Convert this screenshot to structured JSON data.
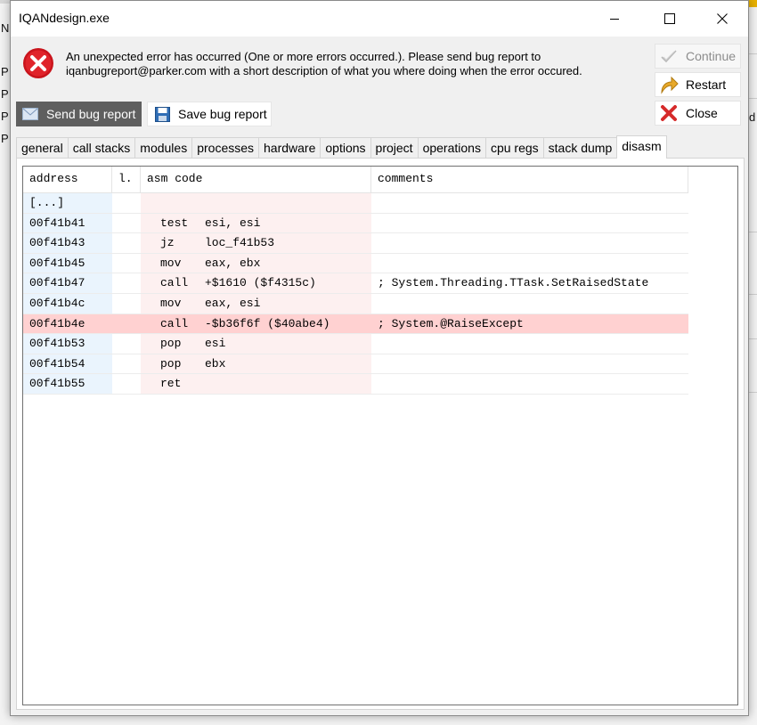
{
  "background": {
    "left_letters": [
      "N",
      "P",
      "P",
      "P",
      "P"
    ],
    "right_letter": "d"
  },
  "window": {
    "title": "IQANdesign.exe"
  },
  "error": {
    "message_line1": "An unexpected error has occurred (One or more errors occurred.). Please send bug report to",
    "message_line2": "iqanbugreport@parker.com with a short description of what you where doing when the error occured."
  },
  "side_buttons": {
    "continue_label": "Continue",
    "restart_label": "Restart",
    "close_label": "Close"
  },
  "bug_buttons": {
    "send_label": "Send bug report",
    "save_label": "Save bug report"
  },
  "tabs": [
    {
      "label": "general"
    },
    {
      "label": "call stacks"
    },
    {
      "label": "modules"
    },
    {
      "label": "processes"
    },
    {
      "label": "hardware"
    },
    {
      "label": "options"
    },
    {
      "label": "project"
    },
    {
      "label": "operations"
    },
    {
      "label": "cpu regs"
    },
    {
      "label": "stack dump"
    },
    {
      "label": "disasm"
    }
  ],
  "active_tab": "disasm",
  "disasm": {
    "columns": {
      "address": "address",
      "line": "l.",
      "asm": "asm code",
      "comments": "comments"
    },
    "rows": [
      {
        "address": "[...]",
        "line": "",
        "op": "",
        "args": "",
        "comment": "",
        "highlight": false
      },
      {
        "address": "00f41b41",
        "line": "",
        "op": "test",
        "args": "esi, esi",
        "comment": "",
        "highlight": false
      },
      {
        "address": "00f41b43",
        "line": "",
        "op": "jz",
        "args": "loc_f41b53",
        "comment": "",
        "highlight": false
      },
      {
        "address": "00f41b45",
        "line": "",
        "op": "mov",
        "args": "eax, ebx",
        "comment": "",
        "highlight": false
      },
      {
        "address": "00f41b47",
        "line": "",
        "op": "call",
        "args": "+$1610 ($f4315c)",
        "comment": "; System.Threading.TTask.SetRaisedState",
        "highlight": false
      },
      {
        "address": "00f41b4c",
        "line": "",
        "op": "mov",
        "args": "eax, esi",
        "comment": "",
        "highlight": false
      },
      {
        "address": "00f41b4e",
        "line": "",
        "op": "call",
        "args": "-$b36f6f ($40abe4)",
        "comment": "; System.@RaiseExcept",
        "highlight": true
      },
      {
        "address": "00f41b53",
        "line": "",
        "op": "pop",
        "args": "esi",
        "comment": "",
        "highlight": false
      },
      {
        "address": "00f41b54",
        "line": "",
        "op": "pop",
        "args": "ebx",
        "comment": "",
        "highlight": false
      },
      {
        "address": "00f41b55",
        "line": "",
        "op": "ret",
        "args": "",
        "comment": "",
        "highlight": false
      }
    ]
  },
  "colors": {
    "highlight_row": "#ffd1d1",
    "address_column": "#eaf4fd",
    "asm_column": "#fdf0f0",
    "error_icon": "#e0242b"
  }
}
